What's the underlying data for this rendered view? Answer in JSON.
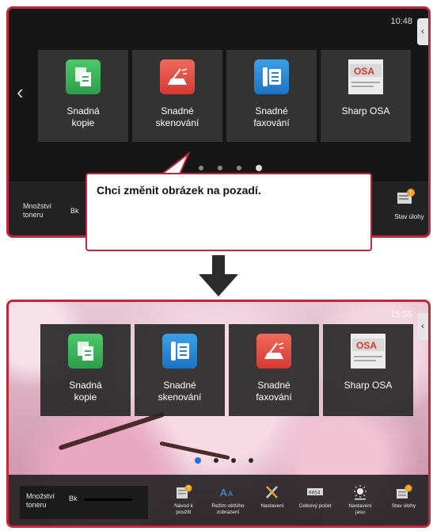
{
  "top_screen": {
    "time": "10:48",
    "tiles": [
      {
        "label": "Snadná\nkopie",
        "icon": "copy-icon"
      },
      {
        "label": "Snadné\nskenování",
        "icon": "scan-icon"
      },
      {
        "label": "Snadné\nfaxování",
        "icon": "fax-icon"
      },
      {
        "label": "Sharp OSA",
        "icon": "osa-icon"
      }
    ],
    "toner_label": "Množství\ntoneru",
    "toner_color": "Bk",
    "job_status": "Stav úlohy"
  },
  "callout": {
    "text": "Chci změnit obrázek na pozadí."
  },
  "bottom_screen": {
    "time": "15:55",
    "tiles": [
      {
        "label": "Snadná\nkopie",
        "icon": "copy-icon"
      },
      {
        "label": "Snadné\nskenování",
        "icon": "fax-icon"
      },
      {
        "label": "Snadné\nfaxování",
        "icon": "scan-icon"
      },
      {
        "label": "Sharp OSA",
        "icon": "osa-icon"
      }
    ],
    "toner_label": "Množství\ntoneru",
    "toner_color": "Bk",
    "functions": [
      {
        "label": "Návod k\npoužití",
        "icon": "guide-icon"
      },
      {
        "label": "Režim většího\nzobrazení",
        "icon": "large-text-icon"
      },
      {
        "label": "Nastavení",
        "icon": "tools-icon"
      },
      {
        "label": "Celkový počet",
        "icon": "counter-icon"
      },
      {
        "label": "Nastavení\njasu",
        "icon": "brightness-icon"
      },
      {
        "label": "Stav úlohy",
        "icon": "job-status-icon"
      }
    ]
  },
  "colors": {
    "frame": "#c0283c",
    "tile_bg": "#333333"
  }
}
